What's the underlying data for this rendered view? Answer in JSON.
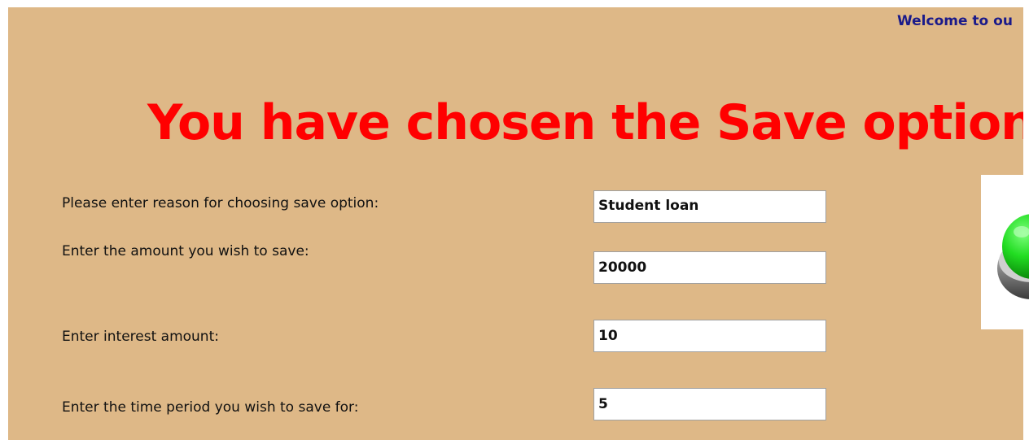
{
  "header": {
    "welcome": "Welcome to ou"
  },
  "headline": "You have chosen the Save option!",
  "form": {
    "reason": {
      "label": "Please enter reason for choosing save option:",
      "value": "Student loan"
    },
    "amount": {
      "label": "Enter the amount you wish to save:",
      "value": "20000"
    },
    "interest": {
      "label": "Enter interest amount:",
      "value": "10"
    },
    "period": {
      "label": "Enter the time period you wish to save for:",
      "value": "5"
    }
  },
  "image": {
    "icon": "green-button-icon"
  },
  "colors": {
    "background": "#deb887",
    "headline": "#ff0000",
    "welcome": "#1a1a8a"
  }
}
